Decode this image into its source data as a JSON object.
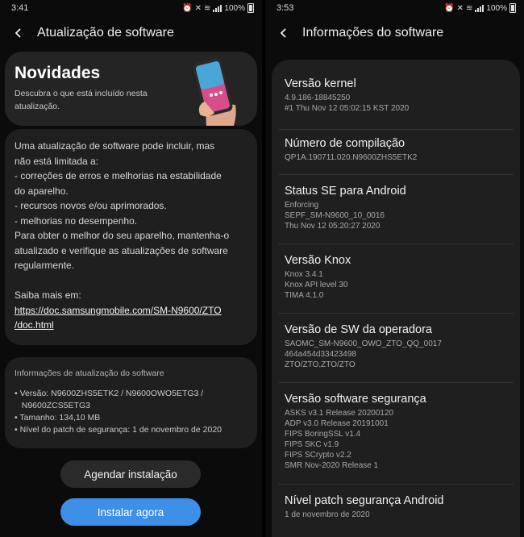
{
  "left": {
    "status": {
      "time": "3:41",
      "battery": "100%"
    },
    "appbar": {
      "title": "Atualização de software"
    },
    "novidades": {
      "title": "Novidades",
      "subtitle": "Descubra o que está incluído nesta atualização."
    },
    "details": {
      "lines": [
        "Uma atualização de software pode incluir, mas",
        "não está limitada a:",
        " - correções de erros e melhorias na estabilidade",
        "do aparelho.",
        " - recursos novos e/ou aprimorados.",
        " - melhorias no desempenho.",
        "Para obter o melhor do seu aparelho, mantenha-o",
        "atualizado e verifique as atualizações de software",
        "regularmente."
      ],
      "saiba_mais": "Saiba mais em:",
      "link_line1": "https://doc.samsungmobile.com/SM-N9600/ZTO",
      "link_line2": "/doc.html"
    },
    "info": {
      "title": "Informações de atualização do software",
      "lines": [
        "• Versão: N9600ZHS5ETK2 / N9600OWO5ETG3 /",
        "   N9600ZCS5ETG3",
        "• Tamanho: 134,10 MB",
        "• Nível do patch de segurança: 1 de novembro de 2020"
      ]
    },
    "buttons": {
      "schedule": "Agendar instalação",
      "install": "Instalar agora"
    }
  },
  "right": {
    "status": {
      "time": "3:53",
      "battery": "100%"
    },
    "appbar": {
      "title": "Informações do software"
    },
    "sections": [
      {
        "title": "Versão kernel",
        "values": [
          "4.9.186-18845250",
          "#1 Thu Nov 12 05:02:15 KST 2020"
        ]
      },
      {
        "title": "Número de compilação",
        "values": [
          "QP1A.190711.020.N9600ZHS5ETK2"
        ]
      },
      {
        "title": "Status SE para Android",
        "values": [
          "Enforcing",
          "SEPF_SM-N9600_10_0016",
          "Thu Nov 12 05:20:27 2020"
        ]
      },
      {
        "title": "Versão Knox",
        "values": [
          "Knox 3.4.1",
          "Knox API level 30",
          "TIMA 4.1.0"
        ]
      },
      {
        "title": "Versão de SW da operadora",
        "values": [
          "SAOMC_SM-N9600_OWO_ZTO_QQ_0017",
          "464a454d33423498",
          "ZTO/ZTO,ZTO/ZTO"
        ]
      },
      {
        "title": "Versão software segurança",
        "values": [
          "ASKS v3.1 Release 20200120",
          "ADP v3.0 Release 20191001",
          "FIPS BoringSSL v1.4",
          "FIPS SKC v1.9",
          "FIPS SCrypto v2.2",
          "SMR Nov-2020 Release 1"
        ]
      },
      {
        "title": "Nível patch segurança Android",
        "values": [
          "1 de novembro de 2020"
        ]
      }
    ]
  },
  "colors": {
    "accent": "#3e8fe8",
    "card": "#1f1f1f",
    "background": "#0b0b0b"
  }
}
